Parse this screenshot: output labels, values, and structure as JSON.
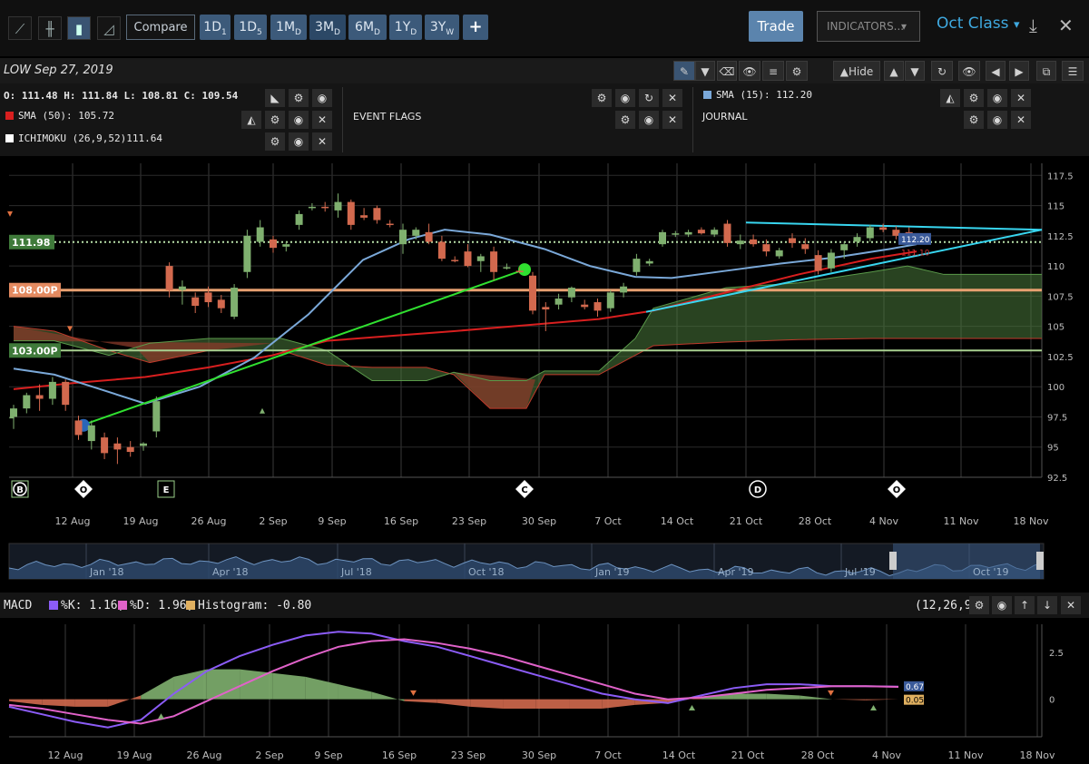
{
  "toolbar": {
    "compare_label": "Compare",
    "ranges": [
      {
        "main": "1D",
        "sub": "1"
      },
      {
        "main": "1D",
        "sub": "5"
      },
      {
        "main": "1M",
        "sub": "D"
      },
      {
        "main": "3M",
        "sub": "D"
      },
      {
        "main": "6M",
        "sub": "D"
      },
      {
        "main": "1Y",
        "sub": "D"
      },
      {
        "main": "3Y",
        "sub": "W"
      }
    ],
    "plus_label": "+",
    "trade_label": "Trade",
    "indicators_label": "INDICATORS...",
    "class_label": "Oct Class",
    "hide_label": "Hide"
  },
  "header": {
    "symbol_date": "LOW  Sep 27, 2019",
    "ohlc": "O: 111.48 H: 111.84 L: 108.81 C: 109.54",
    "sma50": "SMA (50): 105.72",
    "ichimoku": "ICHIMOKU (26,9,52)111.64",
    "event_flags": "EVENT FLAGS",
    "sma15": "SMA (15): 112.20",
    "journal": "JOURNAL"
  },
  "colors": {
    "up": "#7fb06f",
    "down": "#d2694e",
    "sma15": "#7aa8d8",
    "sma50": "#d81f1f",
    "trend_green": "#30e030",
    "trend_cyan": "#38d6f0",
    "cloud_green": "#4a7a3c",
    "cloud_red": "#8a3a2a",
    "level_orange": "#e7a070",
    "level_dotted": "#b8e0a8"
  },
  "chart_data": [
    {
      "type": "candlestick",
      "title": "LOW",
      "x_labels": [
        "12 Aug",
        "19 Aug",
        "26 Aug",
        "2 Sep",
        "9 Sep",
        "16 Sep",
        "23 Sep",
        "30 Sep",
        "7 Oct",
        "14 Oct",
        "21 Oct",
        "28 Oct",
        "4 Nov",
        "11 Nov",
        "18 Nov"
      ],
      "ylim": [
        92.5,
        118.5
      ],
      "y_ticks": [
        92.5,
        95,
        97.5,
        100,
        102.5,
        105,
        107.5,
        110,
        112.5,
        115,
        117.5
      ],
      "candles": [
        {
          "o": 97.5,
          "h": 98.5,
          "l": 96.5,
          "c": 98.2
        },
        {
          "o": 98.2,
          "h": 99.5,
          "l": 97.8,
          "c": 99.3
        },
        {
          "o": 99.3,
          "h": 100.2,
          "l": 98.0,
          "c": 99.0
        },
        {
          "o": 99.0,
          "h": 100.8,
          "l": 98.5,
          "c": 100.4
        },
        {
          "o": 100.4,
          "h": 100.6,
          "l": 98.0,
          "c": 98.5
        },
        {
          "o": 97.2,
          "h": 97.6,
          "l": 95.6,
          "c": 96.0
        },
        {
          "o": 95.5,
          "h": 97.2,
          "l": 94.8,
          "c": 96.8
        },
        {
          "o": 95.8,
          "h": 96.2,
          "l": 94.0,
          "c": 94.5
        },
        {
          "o": 95.3,
          "h": 95.8,
          "l": 93.6,
          "c": 94.8
        },
        {
          "o": 95.0,
          "h": 95.5,
          "l": 94.2,
          "c": 94.6
        },
        {
          "o": 95.1,
          "h": 95.4,
          "l": 94.7,
          "c": 95.3
        },
        {
          "o": 96.3,
          "h": 99.2,
          "l": 95.8,
          "c": 98.8
        },
        {
          "o": 110.0,
          "h": 110.3,
          "l": 107.4,
          "c": 108.0
        },
        {
          "o": 108.0,
          "h": 108.8,
          "l": 106.8,
          "c": 108.3
        },
        {
          "o": 107.4,
          "h": 107.8,
          "l": 106.1,
          "c": 106.7
        },
        {
          "o": 107.8,
          "h": 108.3,
          "l": 106.6,
          "c": 107.0
        },
        {
          "o": 107.2,
          "h": 107.6,
          "l": 106.1,
          "c": 106.5
        },
        {
          "o": 105.8,
          "h": 108.5,
          "l": 105.6,
          "c": 108.2
        },
        {
          "o": 109.5,
          "h": 113.0,
          "l": 109.0,
          "c": 112.5
        },
        {
          "o": 112.0,
          "h": 113.8,
          "l": 111.6,
          "c": 113.2
        },
        {
          "o": 112.2,
          "h": 112.5,
          "l": 111.1,
          "c": 111.5
        },
        {
          "o": 111.6,
          "h": 112.0,
          "l": 111.2,
          "c": 111.8
        },
        {
          "o": 113.4,
          "h": 114.6,
          "l": 113.0,
          "c": 114.3
        },
        {
          "o": 114.8,
          "h": 115.2,
          "l": 114.6,
          "c": 114.9
        },
        {
          "o": 114.9,
          "h": 115.3,
          "l": 114.5,
          "c": 114.8
        },
        {
          "o": 114.6,
          "h": 116.0,
          "l": 114.0,
          "c": 115.3
        },
        {
          "o": 115.3,
          "h": 115.5,
          "l": 113.0,
          "c": 113.4
        },
        {
          "o": 114.2,
          "h": 114.8,
          "l": 113.8,
          "c": 114.0
        },
        {
          "o": 114.8,
          "h": 115.0,
          "l": 113.5,
          "c": 113.8
        },
        {
          "o": 113.5,
          "h": 113.8,
          "l": 113.2,
          "c": 113.4
        },
        {
          "o": 111.8,
          "h": 113.5,
          "l": 111.0,
          "c": 113.0
        },
        {
          "o": 112.5,
          "h": 113.2,
          "l": 112.2,
          "c": 113.0
        },
        {
          "o": 112.8,
          "h": 113.5,
          "l": 111.8,
          "c": 112.0
        },
        {
          "o": 112.0,
          "h": 112.5,
          "l": 110.4,
          "c": 110.6
        },
        {
          "o": 110.5,
          "h": 110.8,
          "l": 110.3,
          "c": 110.4
        },
        {
          "o": 111.2,
          "h": 111.8,
          "l": 109.9,
          "c": 110.0
        },
        {
          "o": 110.4,
          "h": 111.0,
          "l": 109.5,
          "c": 110.8
        },
        {
          "o": 111.2,
          "h": 111.6,
          "l": 108.8,
          "c": 109.5
        },
        {
          "o": 109.8,
          "h": 110.2,
          "l": 109.7,
          "c": 109.9
        },
        {
          "o": 109.6,
          "h": 109.9,
          "l": 109.4,
          "c": 109.5
        },
        {
          "o": 109.2,
          "h": 109.5,
          "l": 106.0,
          "c": 106.3
        },
        {
          "o": 106.6,
          "h": 107.0,
          "l": 104.6,
          "c": 106.4
        },
        {
          "o": 106.8,
          "h": 107.7,
          "l": 106.4,
          "c": 107.3
        },
        {
          "o": 107.4,
          "h": 108.3,
          "l": 107.0,
          "c": 108.2
        },
        {
          "o": 106.8,
          "h": 107.2,
          "l": 106.4,
          "c": 106.6
        },
        {
          "o": 107.0,
          "h": 107.3,
          "l": 105.8,
          "c": 106.3
        },
        {
          "o": 106.5,
          "h": 108.0,
          "l": 106.2,
          "c": 107.8
        },
        {
          "o": 107.8,
          "h": 108.6,
          "l": 107.4,
          "c": 108.3
        },
        {
          "o": 109.5,
          "h": 111.0,
          "l": 109.2,
          "c": 110.6
        },
        {
          "o": 110.2,
          "h": 110.6,
          "l": 110.0,
          "c": 110.4
        },
        {
          "o": 111.8,
          "h": 113.0,
          "l": 111.6,
          "c": 112.8
        },
        {
          "o": 112.6,
          "h": 112.9,
          "l": 112.4,
          "c": 112.7
        },
        {
          "o": 112.6,
          "h": 113.0,
          "l": 112.4,
          "c": 112.8
        },
        {
          "o": 113.0,
          "h": 113.2,
          "l": 112.6,
          "c": 112.7
        },
        {
          "o": 112.6,
          "h": 113.2,
          "l": 112.4,
          "c": 113.0
        },
        {
          "o": 113.5,
          "h": 113.8,
          "l": 111.6,
          "c": 111.9
        },
        {
          "o": 111.8,
          "h": 112.6,
          "l": 111.4,
          "c": 112.1
        },
        {
          "o": 112.2,
          "h": 112.6,
          "l": 111.6,
          "c": 111.8
        },
        {
          "o": 111.8,
          "h": 112.2,
          "l": 110.8,
          "c": 111.2
        },
        {
          "o": 110.8,
          "h": 111.5,
          "l": 110.6,
          "c": 111.3
        },
        {
          "o": 112.3,
          "h": 112.7,
          "l": 111.5,
          "c": 111.9
        },
        {
          "o": 111.8,
          "h": 112.3,
          "l": 111.0,
          "c": 111.4
        },
        {
          "o": 110.9,
          "h": 111.3,
          "l": 109.3,
          "c": 109.6
        },
        {
          "o": 109.8,
          "h": 111.4,
          "l": 109.5,
          "c": 111.1
        },
        {
          "o": 111.3,
          "h": 112.0,
          "l": 110.6,
          "c": 111.8
        },
        {
          "o": 112.0,
          "h": 112.7,
          "l": 111.6,
          "c": 112.4
        },
        {
          "o": 112.3,
          "h": 113.4,
          "l": 112.0,
          "c": 113.2
        },
        {
          "o": 113.2,
          "h": 113.5,
          "l": 112.8,
          "c": 113.0
        },
        {
          "o": 113.0,
          "h": 113.3,
          "l": 112.2,
          "c": 112.5
        },
        {
          "o": 112.8,
          "h": 113.2,
          "l": 112.0,
          "c": 112.3
        }
      ],
      "sma15": {
        "name": "SMA (15)",
        "last": 112.2
      },
      "sma50": {
        "name": "SMA (50)",
        "last": 105.72
      },
      "ichimoku": {
        "name": "ICHIMOKU (26,9,52)",
        "last": 111.64
      },
      "levels": [
        {
          "label": "111.98",
          "value": 111.98,
          "style": "dotted"
        },
        {
          "label": "108.00P",
          "value": 108.0,
          "style": "solid"
        },
        {
          "label": "103.00P",
          "value": 103.0,
          "style": "solid"
        }
      ],
      "price_tags": [
        "112.20",
        "111.10"
      ],
      "event_markers": [
        "B",
        "O",
        "E",
        "C",
        "D",
        "O"
      ]
    },
    {
      "type": "line",
      "title": "MACD",
      "x_labels": [
        "12 Aug",
        "19 Aug",
        "26 Aug",
        "2 Sep",
        "9 Sep",
        "16 Sep",
        "23 Sep",
        "30 Sep",
        "7 Oct",
        "14 Oct",
        "21 Oct",
        "28 Oct",
        "4 Nov",
        "11 Nov",
        "18 Nov"
      ],
      "ylim": [
        -2.0,
        4.0
      ],
      "y_ticks": [
        0,
        2.5
      ],
      "params": "(12,26,9)",
      "series": [
        {
          "name": "%K",
          "label": "%K: 1.16,",
          "color": "#8b5cf6",
          "values": [
            -0.4,
            -0.8,
            -1.2,
            -1.5,
            -1.1,
            0.3,
            1.5,
            2.3,
            2.9,
            3.4,
            3.6,
            3.5,
            3.1,
            2.8,
            2.3,
            1.8,
            1.3,
            0.8,
            0.3,
            0.0,
            -0.2,
            0.2,
            0.6,
            0.8,
            0.8,
            0.7,
            0.7,
            0.67
          ]
        },
        {
          "name": "%D",
          "label": "%D: 1.96,",
          "color": "#e062c9",
          "values": [
            -0.3,
            -0.5,
            -0.8,
            -1.1,
            -1.3,
            -0.9,
            -0.1,
            0.7,
            1.5,
            2.2,
            2.8,
            3.1,
            3.2,
            3.0,
            2.7,
            2.3,
            1.8,
            1.3,
            0.8,
            0.3,
            0.0,
            0.1,
            0.3,
            0.5,
            0.6,
            0.7,
            0.7,
            0.66
          ]
        },
        {
          "name": "Histogram",
          "label": "Histogram: -0.80",
          "color": "#e0b060",
          "values": [
            -0.1,
            -0.3,
            -0.4,
            -0.4,
            0.2,
            1.2,
            1.6,
            1.6,
            1.4,
            1.2,
            0.8,
            0.4,
            -0.1,
            -0.2,
            -0.4,
            -0.5,
            -0.5,
            -0.5,
            -0.5,
            -0.3,
            -0.2,
            0.1,
            0.3,
            0.3,
            0.2,
            0.0,
            -0.05,
            0.0
          ]
        }
      ],
      "tags": [
        "0.67",
        "0.05"
      ]
    },
    {
      "type": "area",
      "title": "navigator",
      "x_labels": [
        "Jan '18",
        "Apr '18",
        "Jul '18",
        "Oct '18",
        "Jan '19",
        "Apr '19",
        "Jul '19",
        "Oct '19"
      ]
    }
  ]
}
